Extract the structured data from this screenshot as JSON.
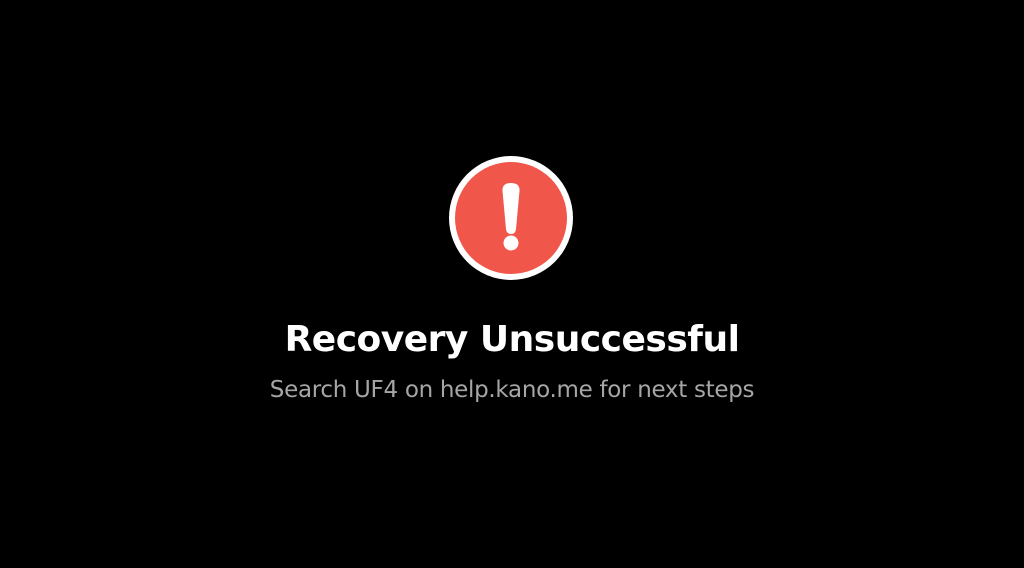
{
  "screen": {
    "background_color": "#000000",
    "icon": {
      "name": "exclamation-alert-icon",
      "fill_color": "#f0564a",
      "ring_color": "#ffffff",
      "glyph_color": "#ffffff"
    },
    "title": "Recovery Unsuccessful",
    "subtitle": "Search UF4 on help.kano.me for next steps"
  }
}
